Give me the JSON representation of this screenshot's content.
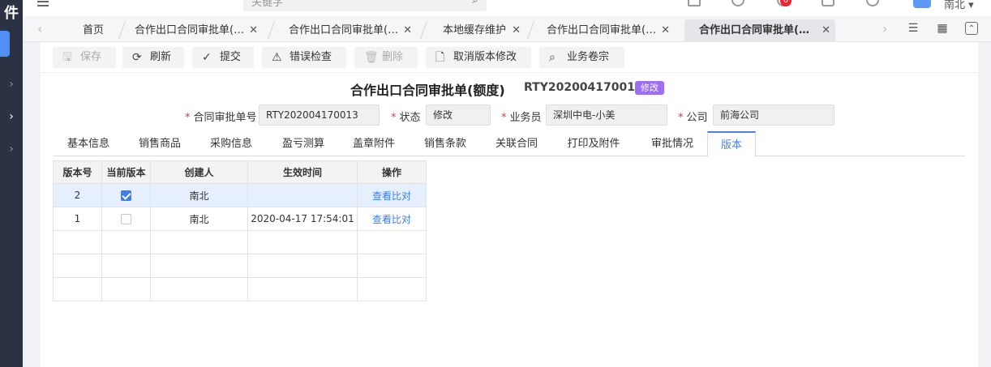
{
  "sidebar": {
    "logo_char": "件"
  },
  "header": {
    "search_placeholder": "关键字",
    "notification_count": "0",
    "user_name": "南北"
  },
  "tabs": [
    {
      "label": "首页",
      "closable": false
    },
    {
      "label": "合作出口合同审批单(…",
      "closable": true
    },
    {
      "label": "合作出口合同审批单(…",
      "closable": true
    },
    {
      "label": "本地缓存维护",
      "closable": true
    },
    {
      "label": "合作出口合同审批单(…",
      "closable": true
    },
    {
      "label": "合作出口合同审批单(…",
      "closable": true,
      "active": true
    }
  ],
  "toolbar": {
    "save": "保存",
    "refresh": "刷新",
    "submit": "提交",
    "error_check": "错误检查",
    "delete": "删除",
    "cancel_version": "取消版本修改",
    "business_file": "业务卷宗"
  },
  "document": {
    "title": "合作出口合同审批单(额度)",
    "number": "RTY202004170013",
    "status_tag": "修改",
    "status_tag_color": "#9b6ef3"
  },
  "fields": {
    "approval_no_label": "合同审批单号",
    "approval_no_value": "RTY202004170013",
    "status_label": "状态",
    "status_value": "修改",
    "salesman_label": "业务员",
    "salesman_value": "深圳中电-小美",
    "company_label": "公司",
    "company_value": "前海公司"
  },
  "sub_tabs": [
    "基本信息",
    "销售商品",
    "采购信息",
    "盈亏测算",
    "盖章附件",
    "销售条款",
    "关联合同",
    "打印及附件",
    "审批情况",
    "版本"
  ],
  "version_table": {
    "columns": [
      "版本号",
      "当前版本",
      "创建人",
      "生效时间",
      "操作"
    ],
    "rows": [
      {
        "version": "2",
        "current": true,
        "creator": "南北",
        "effective_time": "",
        "action": "查看比对"
      },
      {
        "version": "1",
        "current": false,
        "creator": "南北",
        "effective_time": "2020-04-17 17:54:01",
        "action": "查看比对"
      }
    ]
  },
  "colors": {
    "accent": "#4a7ef2",
    "sidebar_bg": "#2a3243"
  }
}
